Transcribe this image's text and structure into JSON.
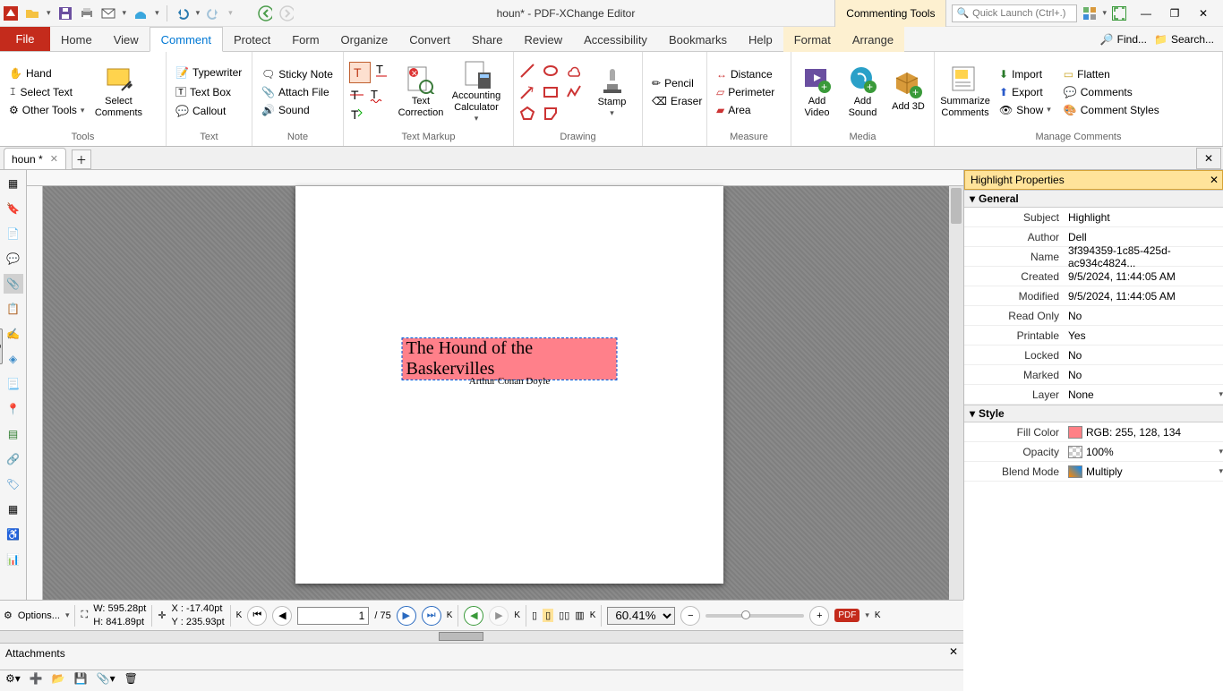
{
  "app": {
    "title": "houn* - PDF-XChange Editor"
  },
  "context_tab": "Commenting Tools",
  "quick_launch_placeholder": "Quick Launch (Ctrl+.)",
  "window_buttons": {
    "min": "—",
    "max": "❐",
    "close": "✕"
  },
  "row2_right": {
    "find": "Find...",
    "search": "Search..."
  },
  "file_label": "File",
  "main_tabs": [
    "Home",
    "View",
    "Comment",
    "Protect",
    "Form",
    "Organize",
    "Convert",
    "Share",
    "Review",
    "Accessibility",
    "Bookmarks",
    "Help"
  ],
  "context_tabs": [
    "Format",
    "Arrange"
  ],
  "active_tab": "Comment",
  "ribbon": {
    "tools": {
      "hand": "Hand",
      "select_text": "Select Text",
      "other_tools": "Other Tools",
      "select_comments": "Select Comments",
      "footer": "Tools"
    },
    "text_group": {
      "typewriter": "Typewriter",
      "text_box": "Text Box",
      "callout": "Callout",
      "footer": "Text"
    },
    "note_group": {
      "sticky": "Sticky Note",
      "attach": "Attach File",
      "sound": "Sound",
      "footer": "Note"
    },
    "text_markup": {
      "text_correction": "Text Correction",
      "accounting_calc": "Accounting Calculator",
      "footer": "Text Markup"
    },
    "drawing": {
      "stamp": "Stamp",
      "footer": "Drawing"
    },
    "pencil_group": {
      "pencil": "Pencil",
      "eraser": "Eraser"
    },
    "measure": {
      "distance": "Distance",
      "perimeter": "Perimeter",
      "area": "Area",
      "footer": "Measure"
    },
    "media": {
      "video": "Add Video",
      "sound": "Add Sound",
      "threeD": "Add 3D",
      "footer": "Media"
    },
    "manage": {
      "summarize": "Summarize Comments",
      "import": "Import",
      "export": "Export",
      "show": "Show",
      "flatten": "Flatten",
      "comments": "Comments",
      "styles": "Comment Styles",
      "footer": "Manage Comments"
    }
  },
  "doc_tab": {
    "name": "houn *"
  },
  "page1": {
    "title": "The Hound of the Baskervilles",
    "author": "Arthur Conan Doyle"
  },
  "properties": {
    "panel_title": "Highlight Properties",
    "sections": {
      "general": "General",
      "style": "Style"
    },
    "general": {
      "Subject": "Highlight",
      "Author": "Dell",
      "Name": "3f394359-1c85-425d-ac934c4824...",
      "Created": "9/5/2024, 11:44:05 AM",
      "Modified": "9/5/2024, 11:44:05 AM",
      "Read Only": "No",
      "Printable": "Yes",
      "Locked": "No",
      "Marked": "No",
      "Layer": "None"
    },
    "style": {
      "Fill Color": "RGB: 255, 128, 134",
      "Opacity": "100%",
      "Blend Mode": "Multiply"
    },
    "fill_color_hex": "#ff8086"
  },
  "status": {
    "options": "Options...",
    "W": "W: 595.28pt",
    "H": "H: 841.89pt",
    "X": "X :   -17.40pt",
    "Y": "Y : 235.93pt",
    "page": "1",
    "total": "75",
    "zoom": "60.41%"
  },
  "attachments": {
    "title": "Attachments"
  }
}
